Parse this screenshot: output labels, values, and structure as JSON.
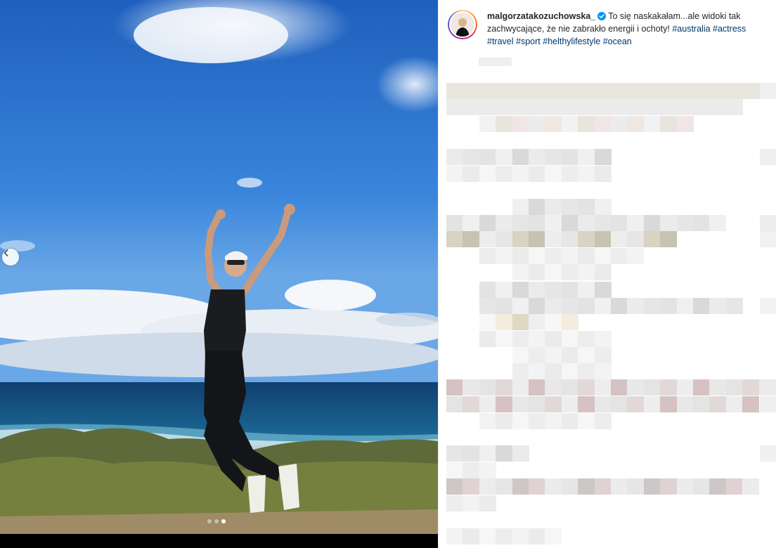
{
  "post": {
    "username": "malgorzatakozuchowska_",
    "verified": true,
    "caption_text": "To się naskakałam...ale widoki tak zachwycające, że nie zabrakło energii i ochoty!",
    "hashtags": [
      "#australia",
      "#actress",
      "#travel",
      "#sport",
      "#helthylifestyle",
      "#ocean"
    ]
  },
  "carousel": {
    "slide_count": 3,
    "active_index": 2,
    "prev_icon": "chevron-left-icon"
  },
  "colors": {
    "hashtag": "#00376b",
    "verified": "#0095f6",
    "sky_top": "#1e5fbd",
    "ocean": "#12467a"
  }
}
